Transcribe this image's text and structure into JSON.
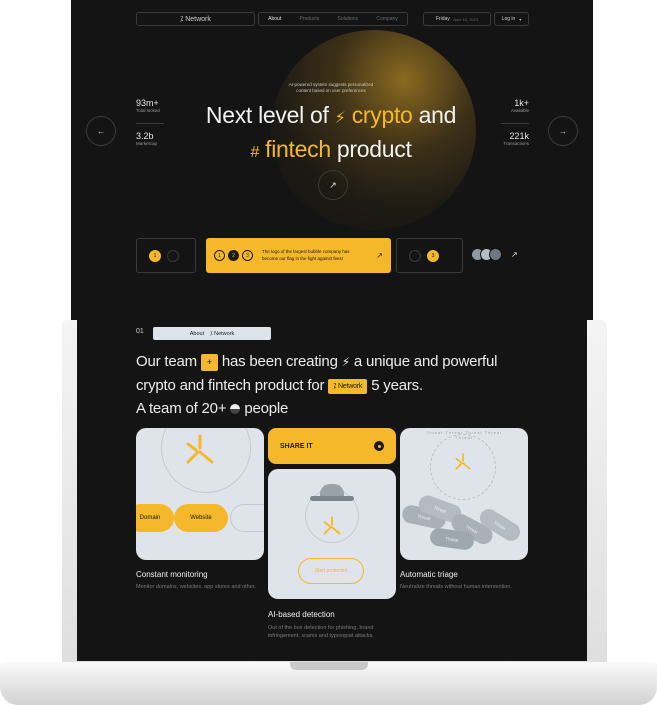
{
  "nav": {
    "logo": "⁒ Network",
    "links": [
      "About",
      "Products",
      "Solutions",
      "Company"
    ],
    "date_day": "Friday",
    "date_full": "June 16, 2023",
    "login": "Log in",
    "login_caret": "▾"
  },
  "hero": {
    "tagline": "AI-powered system suggests personalized content based on user preferences",
    "title_a": "Next level of",
    "title_b": "crypto",
    "title_c": "and",
    "title_d": "fintech",
    "title_e": "product",
    "bolt": "⚡",
    "hash": "#",
    "arrow": "↗"
  },
  "stats_left": [
    {
      "value": "93m+",
      "label": "Total locked"
    },
    {
      "value": "3.2b",
      "label": "Marketcap"
    }
  ],
  "stats_right": [
    {
      "value": "1k+",
      "label": "Available"
    },
    {
      "value": "221k",
      "label": "Transactions"
    }
  ],
  "nav_arrows": {
    "prev": "←",
    "next": "→"
  },
  "slider": {
    "n1": "1",
    "n2": "2",
    "n3": "3",
    "card_text": "The logo of the largest bubble company has become our flag in the fight against fees!",
    "arrow": "↗"
  },
  "about": {
    "number": "01",
    "tab_about": "About",
    "tab_network": "⁒ Network",
    "line1_a": "Our team",
    "line1_plus": "+",
    "line1_b": "has been creating",
    "line1_bolt": "⚡",
    "line1_c": "a unique and powerful",
    "line2_a": "crypto and fintech product for",
    "line2_badge": "⁒ Network",
    "line2_b": "5 years.",
    "line3_a": "A team of 20+",
    "line3_b": "people"
  },
  "cards": {
    "c1_chip1": "Domain",
    "c1_chip2": "Website",
    "c1_title": "Constant monitoring",
    "c1_desc": "Monitor domains, websites, app stores and other.",
    "share": "SHARE IT",
    "c2_tag": "Start protected",
    "c2_title": "AI-based detection",
    "c2_desc": "Out of the box detection for phishing, brand infringement, scams and typosquat attacks.",
    "c3_ring": "Threat Threat Threat Threat Threat",
    "c3_pills": [
      "Threat",
      "Threat",
      "Threat",
      "Threat",
      "Threat"
    ],
    "c3_title": "Automatic triage",
    "c3_desc": "Neutralize threats without human intervention."
  },
  "colors": {
    "accent": "#f5b82a",
    "bg": "#141414",
    "card": "#dfe4ea"
  }
}
